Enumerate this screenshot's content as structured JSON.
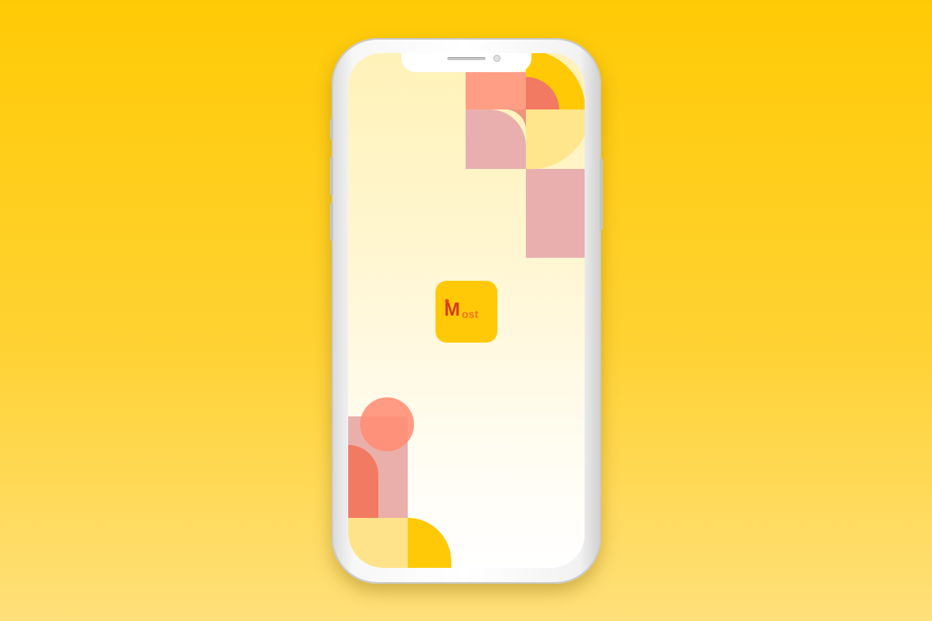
{
  "device": {
    "type": "smartphone",
    "icons": [
      "speaker-grille-icon",
      "front-camera-icon"
    ]
  },
  "screen": {
    "type": "splash",
    "app_icon": {
      "logo_initial": "M",
      "logo_rest": "ost",
      "colors": {
        "background": "#FFC907",
        "initial": "#D63A16",
        "rest": "#EE7A1F",
        "dot": "#E84A1C"
      }
    }
  },
  "theme": {
    "background": "#FFCA05",
    "screen_top": "#FFF2B8",
    "screen_bottom": "#FFFFFF",
    "coral": "#F5856A",
    "salmon": "#FF9E84",
    "pink": "#E9A9A8",
    "yellow": "#FFCA05",
    "pale_yellow": "#FFE58C"
  }
}
